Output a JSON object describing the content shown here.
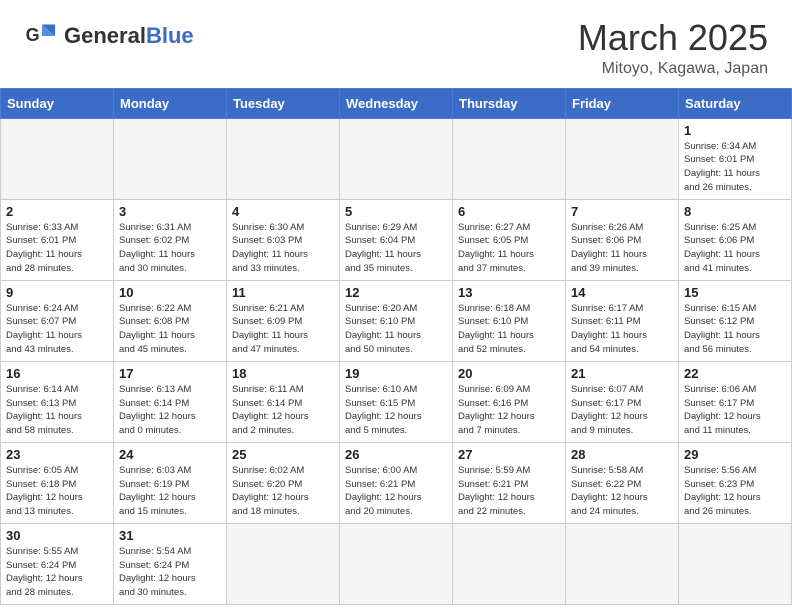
{
  "header": {
    "logo_general": "General",
    "logo_blue": "Blue",
    "month_year": "March 2025",
    "location": "Mitoyo, Kagawa, Japan"
  },
  "weekdays": [
    "Sunday",
    "Monday",
    "Tuesday",
    "Wednesday",
    "Thursday",
    "Friday",
    "Saturday"
  ],
  "weeks": [
    [
      {
        "day": "",
        "info": ""
      },
      {
        "day": "",
        "info": ""
      },
      {
        "day": "",
        "info": ""
      },
      {
        "day": "",
        "info": ""
      },
      {
        "day": "",
        "info": ""
      },
      {
        "day": "",
        "info": ""
      },
      {
        "day": "1",
        "info": "Sunrise: 6:34 AM\nSunset: 6:01 PM\nDaylight: 11 hours\nand 26 minutes."
      }
    ],
    [
      {
        "day": "2",
        "info": "Sunrise: 6:33 AM\nSunset: 6:01 PM\nDaylight: 11 hours\nand 28 minutes."
      },
      {
        "day": "3",
        "info": "Sunrise: 6:31 AM\nSunset: 6:02 PM\nDaylight: 11 hours\nand 30 minutes."
      },
      {
        "day": "4",
        "info": "Sunrise: 6:30 AM\nSunset: 6:03 PM\nDaylight: 11 hours\nand 33 minutes."
      },
      {
        "day": "5",
        "info": "Sunrise: 6:29 AM\nSunset: 6:04 PM\nDaylight: 11 hours\nand 35 minutes."
      },
      {
        "day": "6",
        "info": "Sunrise: 6:27 AM\nSunset: 6:05 PM\nDaylight: 11 hours\nand 37 minutes."
      },
      {
        "day": "7",
        "info": "Sunrise: 6:26 AM\nSunset: 6:06 PM\nDaylight: 11 hours\nand 39 minutes."
      },
      {
        "day": "8",
        "info": "Sunrise: 6:25 AM\nSunset: 6:06 PM\nDaylight: 11 hours\nand 41 minutes."
      }
    ],
    [
      {
        "day": "9",
        "info": "Sunrise: 6:24 AM\nSunset: 6:07 PM\nDaylight: 11 hours\nand 43 minutes."
      },
      {
        "day": "10",
        "info": "Sunrise: 6:22 AM\nSunset: 6:08 PM\nDaylight: 11 hours\nand 45 minutes."
      },
      {
        "day": "11",
        "info": "Sunrise: 6:21 AM\nSunset: 6:09 PM\nDaylight: 11 hours\nand 47 minutes."
      },
      {
        "day": "12",
        "info": "Sunrise: 6:20 AM\nSunset: 6:10 PM\nDaylight: 11 hours\nand 50 minutes."
      },
      {
        "day": "13",
        "info": "Sunrise: 6:18 AM\nSunset: 6:10 PM\nDaylight: 11 hours\nand 52 minutes."
      },
      {
        "day": "14",
        "info": "Sunrise: 6:17 AM\nSunset: 6:11 PM\nDaylight: 11 hours\nand 54 minutes."
      },
      {
        "day": "15",
        "info": "Sunrise: 6:15 AM\nSunset: 6:12 PM\nDaylight: 11 hours\nand 56 minutes."
      }
    ],
    [
      {
        "day": "16",
        "info": "Sunrise: 6:14 AM\nSunset: 6:13 PM\nDaylight: 11 hours\nand 58 minutes."
      },
      {
        "day": "17",
        "info": "Sunrise: 6:13 AM\nSunset: 6:14 PM\nDaylight: 12 hours\nand 0 minutes."
      },
      {
        "day": "18",
        "info": "Sunrise: 6:11 AM\nSunset: 6:14 PM\nDaylight: 12 hours\nand 2 minutes."
      },
      {
        "day": "19",
        "info": "Sunrise: 6:10 AM\nSunset: 6:15 PM\nDaylight: 12 hours\nand 5 minutes."
      },
      {
        "day": "20",
        "info": "Sunrise: 6:09 AM\nSunset: 6:16 PM\nDaylight: 12 hours\nand 7 minutes."
      },
      {
        "day": "21",
        "info": "Sunrise: 6:07 AM\nSunset: 6:17 PM\nDaylight: 12 hours\nand 9 minutes."
      },
      {
        "day": "22",
        "info": "Sunrise: 6:06 AM\nSunset: 6:17 PM\nDaylight: 12 hours\nand 11 minutes."
      }
    ],
    [
      {
        "day": "23",
        "info": "Sunrise: 6:05 AM\nSunset: 6:18 PM\nDaylight: 12 hours\nand 13 minutes."
      },
      {
        "day": "24",
        "info": "Sunrise: 6:03 AM\nSunset: 6:19 PM\nDaylight: 12 hours\nand 15 minutes."
      },
      {
        "day": "25",
        "info": "Sunrise: 6:02 AM\nSunset: 6:20 PM\nDaylight: 12 hours\nand 18 minutes."
      },
      {
        "day": "26",
        "info": "Sunrise: 6:00 AM\nSunset: 6:21 PM\nDaylight: 12 hours\nand 20 minutes."
      },
      {
        "day": "27",
        "info": "Sunrise: 5:59 AM\nSunset: 6:21 PM\nDaylight: 12 hours\nand 22 minutes."
      },
      {
        "day": "28",
        "info": "Sunrise: 5:58 AM\nSunset: 6:22 PM\nDaylight: 12 hours\nand 24 minutes."
      },
      {
        "day": "29",
        "info": "Sunrise: 5:56 AM\nSunset: 6:23 PM\nDaylight: 12 hours\nand 26 minutes."
      }
    ],
    [
      {
        "day": "30",
        "info": "Sunrise: 5:55 AM\nSunset: 6:24 PM\nDaylight: 12 hours\nand 28 minutes."
      },
      {
        "day": "31",
        "info": "Sunrise: 5:54 AM\nSunset: 6:24 PM\nDaylight: 12 hours\nand 30 minutes."
      },
      {
        "day": "",
        "info": ""
      },
      {
        "day": "",
        "info": ""
      },
      {
        "day": "",
        "info": ""
      },
      {
        "day": "",
        "info": ""
      },
      {
        "day": "",
        "info": ""
      }
    ]
  ]
}
